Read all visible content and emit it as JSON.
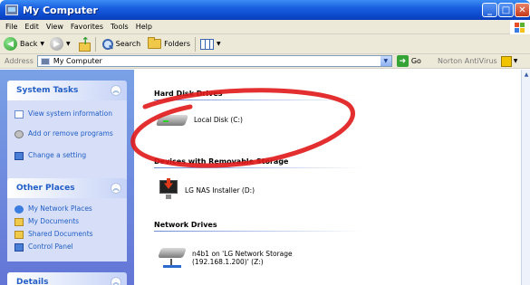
{
  "window": {
    "title": "My Computer"
  },
  "menu": {
    "items": [
      "File",
      "Edit",
      "View",
      "Favorites",
      "Tools",
      "Help"
    ]
  },
  "toolbar": {
    "back_label": "Back",
    "search_label": "Search",
    "folders_label": "Folders"
  },
  "address": {
    "label": "Address",
    "value": "My Computer",
    "go_label": "Go",
    "norton_label": "Norton AntiVirus"
  },
  "left_pane": {
    "system_tasks": {
      "title": "System Tasks",
      "items": [
        {
          "label": "View system information",
          "icon": "info-icon"
        },
        {
          "label": "Add or remove programs",
          "icon": "cd-icon"
        },
        {
          "label": "Change a setting",
          "icon": "control-panel-icon"
        }
      ]
    },
    "other_places": {
      "title": "Other Places",
      "items": [
        {
          "label": "My Network Places",
          "icon": "network-icon"
        },
        {
          "label": "My Documents",
          "icon": "folder-icon"
        },
        {
          "label": "Shared Documents",
          "icon": "folder-icon"
        },
        {
          "label": "Control Panel",
          "icon": "control-panel-icon"
        }
      ]
    },
    "details": {
      "title": "Details"
    }
  },
  "content": {
    "groups": [
      {
        "title": "Hard Disk Drives",
        "items": [
          {
            "label": "Local Disk (C:)"
          }
        ]
      },
      {
        "title": "Devices with Removable Storage",
        "items": [
          {
            "label": "LG NAS Installer (D:)"
          }
        ]
      },
      {
        "title": "Network Drives",
        "items": [
          {
            "label_line1": "n4b1 on 'LG Network Storage",
            "label_line2": "(192.168.1.200)' (Z:)"
          }
        ]
      }
    ]
  },
  "colors": {
    "titlebar": "#0a46c8",
    "task_link": "#215dc6",
    "annotation_circle": "#e01818"
  }
}
